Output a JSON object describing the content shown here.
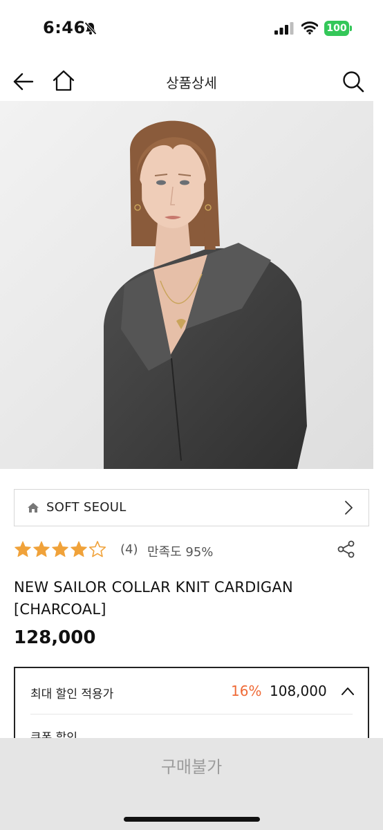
{
  "status_bar": {
    "time": "6:46",
    "battery_level": "100",
    "battery_color": "#34c759",
    "icons": [
      "bell-slash-icon",
      "signal-icon",
      "wifi-icon",
      "battery-icon"
    ]
  },
  "nav": {
    "title": "상품상세",
    "icons": [
      "back-arrow-icon",
      "home-icon",
      "search-icon"
    ]
  },
  "product": {
    "image_alt": "product-photo",
    "brand": "SOFT SEOUL",
    "rating": 4,
    "rating_max": 5,
    "review_count": "(4)",
    "satisfaction": "만족도 95%",
    "name_line1": "NEW SAILOR COLLAR KNIT CARDIGAN",
    "name_line2": "[CHARCOAL]",
    "price": "128,000"
  },
  "discount": {
    "label": "최대 할인 적용가",
    "rate": "16%",
    "price": "108,000",
    "coupon_label": "쿠폰 할인"
  },
  "buy": {
    "label": "구매불가"
  },
  "colors": {
    "star": "#f0a23a",
    "discount_rate": "#ef6a36",
    "buy_bg": "#e5e5e5",
    "buy_text": "#9c9c9c"
  }
}
